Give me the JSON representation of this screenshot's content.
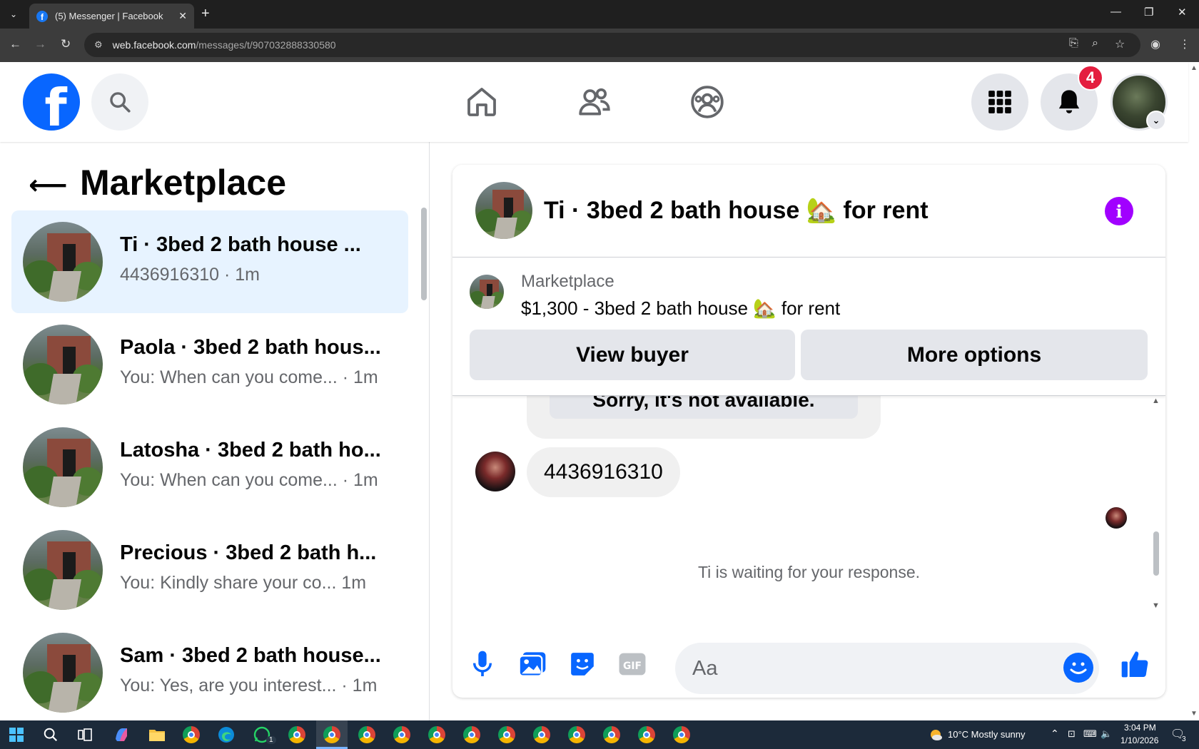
{
  "browser": {
    "tab_title": "(5) Messenger | Facebook",
    "url_host": "web.facebook.com",
    "url_path": "/messages/t/907032888330580"
  },
  "header": {
    "notification_count": "4"
  },
  "left_panel": {
    "title": "Marketplace",
    "conversations": [
      {
        "name": "Ti · 3bed 2 bath house ...",
        "subtitle": "4436916310 · 1m",
        "active": true
      },
      {
        "name": "Paola · 3bed 2 bath hous...",
        "subtitle": "You: When can you come... · 1m",
        "active": false
      },
      {
        "name": "Latosha · 3bed 2 bath ho...",
        "subtitle": "You: When can you come... · 1m",
        "active": false
      },
      {
        "name": "Precious · 3bed 2 bath h...",
        "subtitle": "You: Kindly share your co...   1m",
        "active": false
      },
      {
        "name": "Sam · 3bed 2 bath house...",
        "subtitle": "You: Yes, are you interest... · 1m",
        "active": false
      }
    ]
  },
  "chat": {
    "title": "Ti · 3bed 2 bath house 🏡 for rent",
    "marketplace_label": "Marketplace",
    "listing": "$1,300 - 3bed 2 bath house 🏡 for rent",
    "view_buyer_label": "View buyer",
    "more_options_label": "More options",
    "previous_message": "Sorry, it's not available.",
    "message": "4436916310",
    "waiting_text": "Ti is waiting for your response.",
    "composer_placeholder": "Aa"
  },
  "taskbar": {
    "weather": "10°C  Mostly sunny",
    "time": "3:04 PM",
    "date": "1/10/2026",
    "notification_count": "3",
    "whatsapp_badge": "1"
  },
  "colors": {
    "facebook_blue": "#0866ff",
    "active_conversation": "#e7f3ff",
    "info_purple": "#a100ff",
    "badge_red": "#e41e3f"
  }
}
